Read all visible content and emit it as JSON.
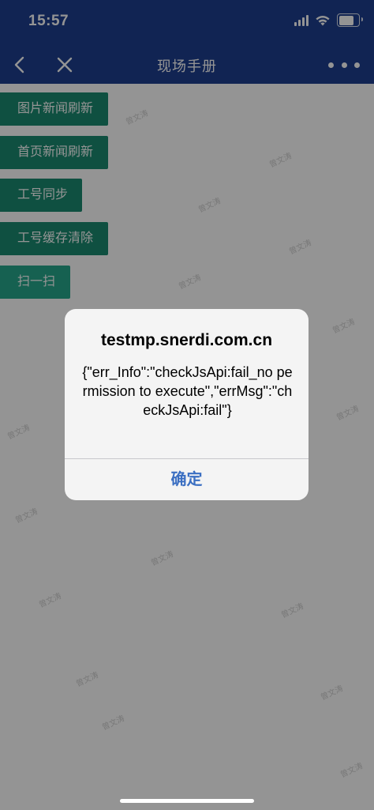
{
  "status_bar": {
    "time": "15:57",
    "icons": [
      "signal-icon",
      "wifi-icon",
      "battery-icon"
    ]
  },
  "nav": {
    "title": "现场手册",
    "back_icon": "back-chevron-icon",
    "close_icon": "close-icon",
    "more_icon": "more-dots-icon"
  },
  "actions": [
    {
      "label": "图片新闻刷新"
    },
    {
      "label": "首页新闻刷新"
    },
    {
      "label": "工号同步"
    },
    {
      "label": "工号缓存清除"
    },
    {
      "label": "扫一扫"
    }
  ],
  "watermark_text": "曾文涛",
  "dialog": {
    "title": "testmp.snerdi.com.cn",
    "message": "{\"err_Info\":\"checkJsApi:fail_no permission to execute\",\"errMsg\":\"checkJsApi:fail\"}",
    "confirm_label": "确定"
  },
  "colors": {
    "header_bg": "#1e3f8f",
    "button_green": "#1a8a70",
    "dialog_button": "#3b6fc2"
  }
}
